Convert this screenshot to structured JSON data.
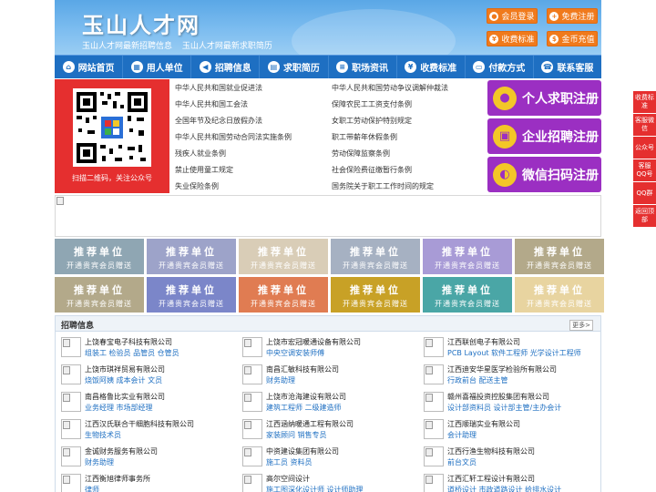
{
  "header": {
    "logo": "玉山人才网",
    "slogans": [
      "玉山人才网最新招聘信息",
      "玉山人才网最新求职简历"
    ],
    "buttons": [
      {
        "label": "会员登录",
        "icon": "user-icon"
      },
      {
        "label": "免费注册",
        "icon": "register-icon"
      },
      {
        "label": "收费标准",
        "icon": "fee-icon"
      },
      {
        "label": "金币充值",
        "icon": "coin-icon"
      }
    ],
    "accent": "#f07a1c"
  },
  "nav": {
    "items": [
      {
        "label": "网站首页",
        "icon": "home-icon"
      },
      {
        "label": "用人单位",
        "icon": "building-icon"
      },
      {
        "label": "招聘信息",
        "icon": "megaphone-icon"
      },
      {
        "label": "求职简历",
        "icon": "resume-icon"
      },
      {
        "label": "职场资讯",
        "icon": "news-icon"
      },
      {
        "label": "收费标准",
        "icon": "fee-icon"
      },
      {
        "label": "付款方式",
        "icon": "payment-icon"
      },
      {
        "label": "联系客服",
        "icon": "phone-icon"
      }
    ],
    "color": "#1e6fc2"
  },
  "qr": {
    "caption": "扫描二维码，关注公众号"
  },
  "laws": {
    "left": [
      "中华人民共和国就业促进法",
      "中华人民共和国工会法",
      "全国年节及纪念日放假办法",
      "中华人民共和国劳动合同法实施条例",
      "残疾人就业条例",
      "禁止使用童工规定",
      "失业保险条例"
    ],
    "right": [
      "中华人民共和国劳动争议调解仲裁法",
      "保障农民工工资支付条例",
      "女职工劳动保护特别规定",
      "职工带薪年休假条例",
      "劳动保障监察条例",
      "社会保险费征缴暂行条例",
      "国务院关于职工工作时间的规定"
    ]
  },
  "register": [
    {
      "label": "个人求职注册",
      "icon": "person-icon"
    },
    {
      "label": "企业招聘注册",
      "icon": "company-icon"
    },
    {
      "label": "微信扫码注册",
      "icon": "wechat-icon"
    }
  ],
  "ads": {
    "title": "推荐单位",
    "subtitle": "开通贵宾会员赠送",
    "colors": [
      "#8fa6b3",
      "#9da3c9",
      "#d9cdb7",
      "#a6b1c2",
      "#a89bd6",
      "#b3a98a",
      "#b3a98a",
      "#7b86c9",
      "#e07c52",
      "#c8a126",
      "#4aa6a6",
      "#e8d4a0",
      "#bcc7ea"
    ]
  },
  "jobs": {
    "title": "招聘信息",
    "more": "更多>",
    "items": [
      {
        "company": "上饶春宝电子科技有限公司",
        "positions": "组装工 检验员 品管员 仓管员"
      },
      {
        "company": "上饶市宏冠暖通设备有限公司",
        "positions": "中央空调安装师傅"
      },
      {
        "company": "江西联创电子有限公司",
        "positions": "PCB Layout 软件工程师 光学设计工程师"
      },
      {
        "company": "上饶市琪祥贸易有限公司",
        "positions": "烧饭阿姨 成本会计 文员"
      },
      {
        "company": "南昌汇敏科技有限公司",
        "positions": "财务助理"
      },
      {
        "company": "江西迪安华星医学检验所有限公司",
        "positions": "行政前台 配送主管"
      },
      {
        "company": "南昌格鲁比实业有限公司",
        "positions": "业务经理 市场部经理"
      },
      {
        "company": "上饶市沧海建设有限公司",
        "positions": "建筑工程师 二级建造师"
      },
      {
        "company": "赣州喜福投资控股集团有限公司",
        "positions": "设计部资料员 设计部主管/主办会计"
      },
      {
        "company": "江西汉氏联合干细胞科技有限公司",
        "positions": "生物技术员"
      },
      {
        "company": "江西涵纳暖通工程有限公司",
        "positions": "家装顾问 销售专员"
      },
      {
        "company": "江西顺瑞实业有限公司",
        "positions": "会计助理"
      },
      {
        "company": "金诚财务服务有限公司",
        "positions": "财务助理"
      },
      {
        "company": "中资建设集团有限公司",
        "positions": "施工员 资料员"
      },
      {
        "company": "江西行渔生物科技有限公司",
        "positions": "前台文员"
      },
      {
        "company": "江西衡旭律师事务所",
        "positions": "律师"
      },
      {
        "company": "高尔空间设计",
        "positions": "施工图深化设计师 设计师助理"
      },
      {
        "company": "江西汇轩工程设计有限公司",
        "positions": "道桥设计 市政道路设计 给排水设计"
      }
    ]
  },
  "side": [
    {
      "label": "收费标准"
    },
    {
      "label": "客服微信"
    },
    {
      "label": "公众号"
    },
    {
      "label": "客服QQ号"
    },
    {
      "label": "QQ群"
    },
    {
      "label": "返回顶部"
    }
  ]
}
